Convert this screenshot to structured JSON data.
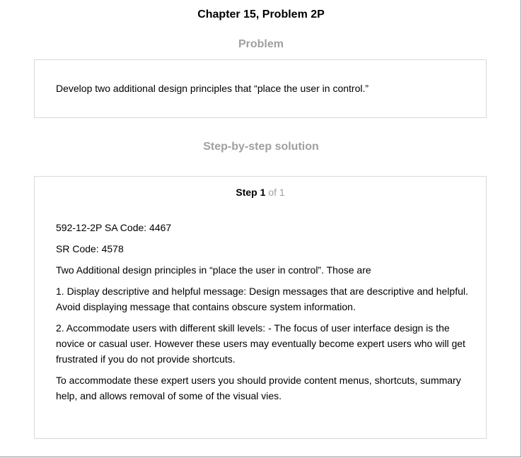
{
  "header": {
    "chapter_title": "Chapter 15, Problem 2P"
  },
  "problem": {
    "heading": "Problem",
    "text": "Develop two additional design principles that “place the user in control.”"
  },
  "solution": {
    "heading": "Step-by-step solution",
    "step": {
      "word": "Step",
      "number": "1",
      "of_text": "of 1"
    },
    "paragraphs": [
      "592-12-2P SA Code: 4467",
      "SR Code: 4578",
      "Two Additional design principles in “place the user in control”. Those are",
      "1. Display descriptive and helpful message: Design messages that are descriptive and helpful. Avoid displaying message that contains obscure system information.",
      "2. Accommodate users with different skill levels: - The focus of user interface design is the novice or casual user. However these users may eventually become expert users who will get frustrated if you do not provide shortcuts.",
      "To accommodate these expert users you should provide content menus, shortcuts, summary help, and allows removal of some of the visual vies."
    ]
  }
}
